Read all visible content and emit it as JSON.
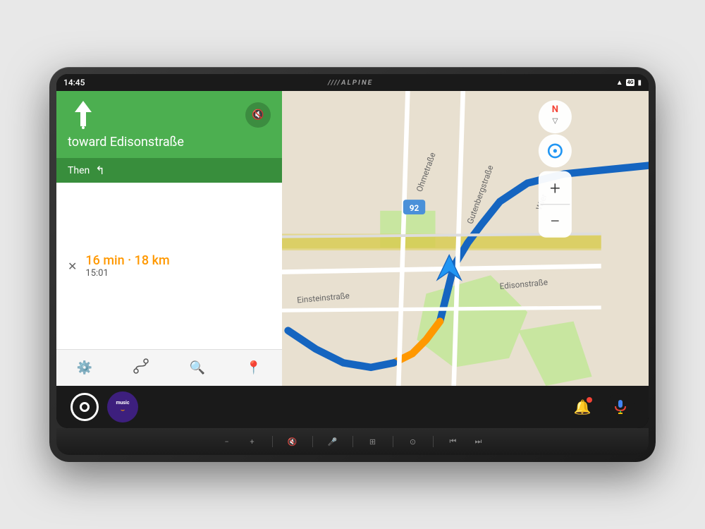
{
  "device": {
    "brand": "////ALPINE"
  },
  "status_bar": {
    "time": "14:45",
    "signal_4g": "4G",
    "battery": "🔋"
  },
  "navigation": {
    "direction_arrow": "↑",
    "direction_dots": "⋮",
    "mute_icon": "🔇",
    "toward_label": "toward Edisonstraße",
    "then_label": "Then",
    "then_turn_arrow": "↰",
    "eta_main": "16 min · 18 km",
    "eta_time": "15:01",
    "close_icon": "✕"
  },
  "toolbar": {
    "settings_icon": "⚙",
    "routes_icon": "⑃",
    "search_icon": "🔍",
    "pin_icon": "📍"
  },
  "map": {
    "road_92_label": "92",
    "street_ohme": "Ohmetraße",
    "street_gutenberg": "Gutenbergstraße",
    "street_einstein": "Einsteinstraße",
    "street_edison": "Edisonstraße",
    "street_wier": "Wier"
  },
  "android_auto": {
    "home_button": "",
    "amazon_music_label": "music",
    "notification_icon": "🔔",
    "mic_icon": "🎤"
  },
  "physical_controls": [
    {
      "id": "vol-down",
      "label": "−"
    },
    {
      "id": "vol-up",
      "label": "+"
    },
    {
      "id": "mute-fav",
      "label": "🔇★"
    },
    {
      "id": "mic",
      "label": "🎤"
    },
    {
      "id": "grid",
      "label": "⊞"
    },
    {
      "id": "nav",
      "label": "⊙"
    },
    {
      "id": "prev",
      "label": "⏮"
    },
    {
      "id": "next",
      "label": "⏭"
    }
  ]
}
